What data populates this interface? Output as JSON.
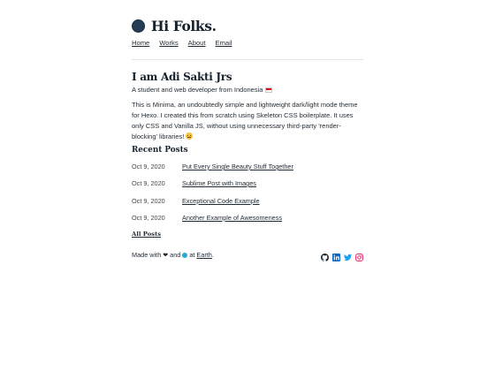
{
  "header": {
    "title": "Hi Folks.",
    "nav": [
      "Home",
      "Works",
      "About",
      "Email"
    ]
  },
  "intro": {
    "title": "I am Adi Sakti Jrs",
    "subtitle": "A student and web developer from Indonesia",
    "bio": "This is Minima, an undoubtedly simple and lightweight dark/light mode theme for Hexo. I created this from scratch using Skeleton CSS boilerplate. It uses only CSS and Vanilla JS, without using unnecessary third-party 'render-blocking' libraries!"
  },
  "recent": {
    "title": "Recent Posts",
    "posts": [
      {
        "date": "Oct 9, 2020",
        "title": "Put Every Single Beauty Stuff Together"
      },
      {
        "date": "Oct 9, 2020",
        "title": "Sublime Post with Images"
      },
      {
        "date": "Oct 9, 2020",
        "title": "Exceptional Code Example"
      },
      {
        "date": "Oct 9, 2020",
        "title": "Another Example of Awesomeness"
      }
    ],
    "all_posts": "All Posts"
  },
  "footer": {
    "made_with": "Made with",
    "and": "and",
    "at": "at",
    "earth": "Earth",
    "period": "."
  },
  "social": [
    {
      "icon": "github-icon"
    },
    {
      "icon": "linkedin-icon"
    },
    {
      "icon": "twitter-icon"
    },
    {
      "icon": "instagram-icon"
    }
  ],
  "colors": {
    "text": "#1f2933",
    "heading": "#16222e",
    "logo": "#273c55",
    "linkedin": "#0a66c2",
    "twitter": "#1da1f2",
    "instagram": "#e1306c"
  }
}
